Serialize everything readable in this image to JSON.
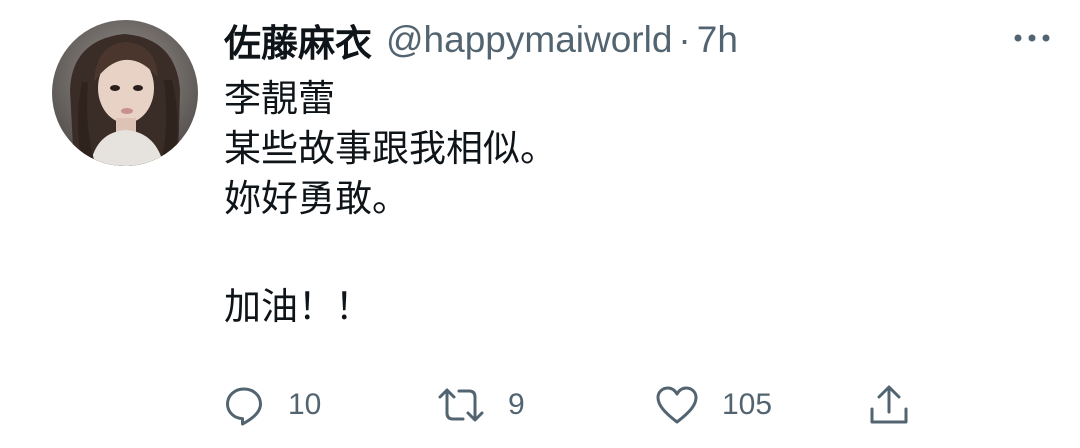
{
  "tweet": {
    "display_name": "佐藤麻衣",
    "handle": "@happymaiworld",
    "separator": "·",
    "time": "7h",
    "text_lines": [
      "李靚蕾",
      "某些故事跟我相似。",
      "妳好勇敢。",
      "加油！！"
    ]
  },
  "actions": {
    "reply": {
      "icon": "speech-bubble-icon",
      "count": "10"
    },
    "retweet": {
      "icon": "retweet-icon",
      "count": "9"
    },
    "like": {
      "icon": "heart-icon",
      "count": "105"
    },
    "share": {
      "icon": "share-upload-icon"
    }
  },
  "more_menu": {
    "icon": "more-horizontal-icon"
  },
  "colors": {
    "text_primary": "#0f1419",
    "text_secondary": "#536471",
    "background": "#ffffff"
  }
}
